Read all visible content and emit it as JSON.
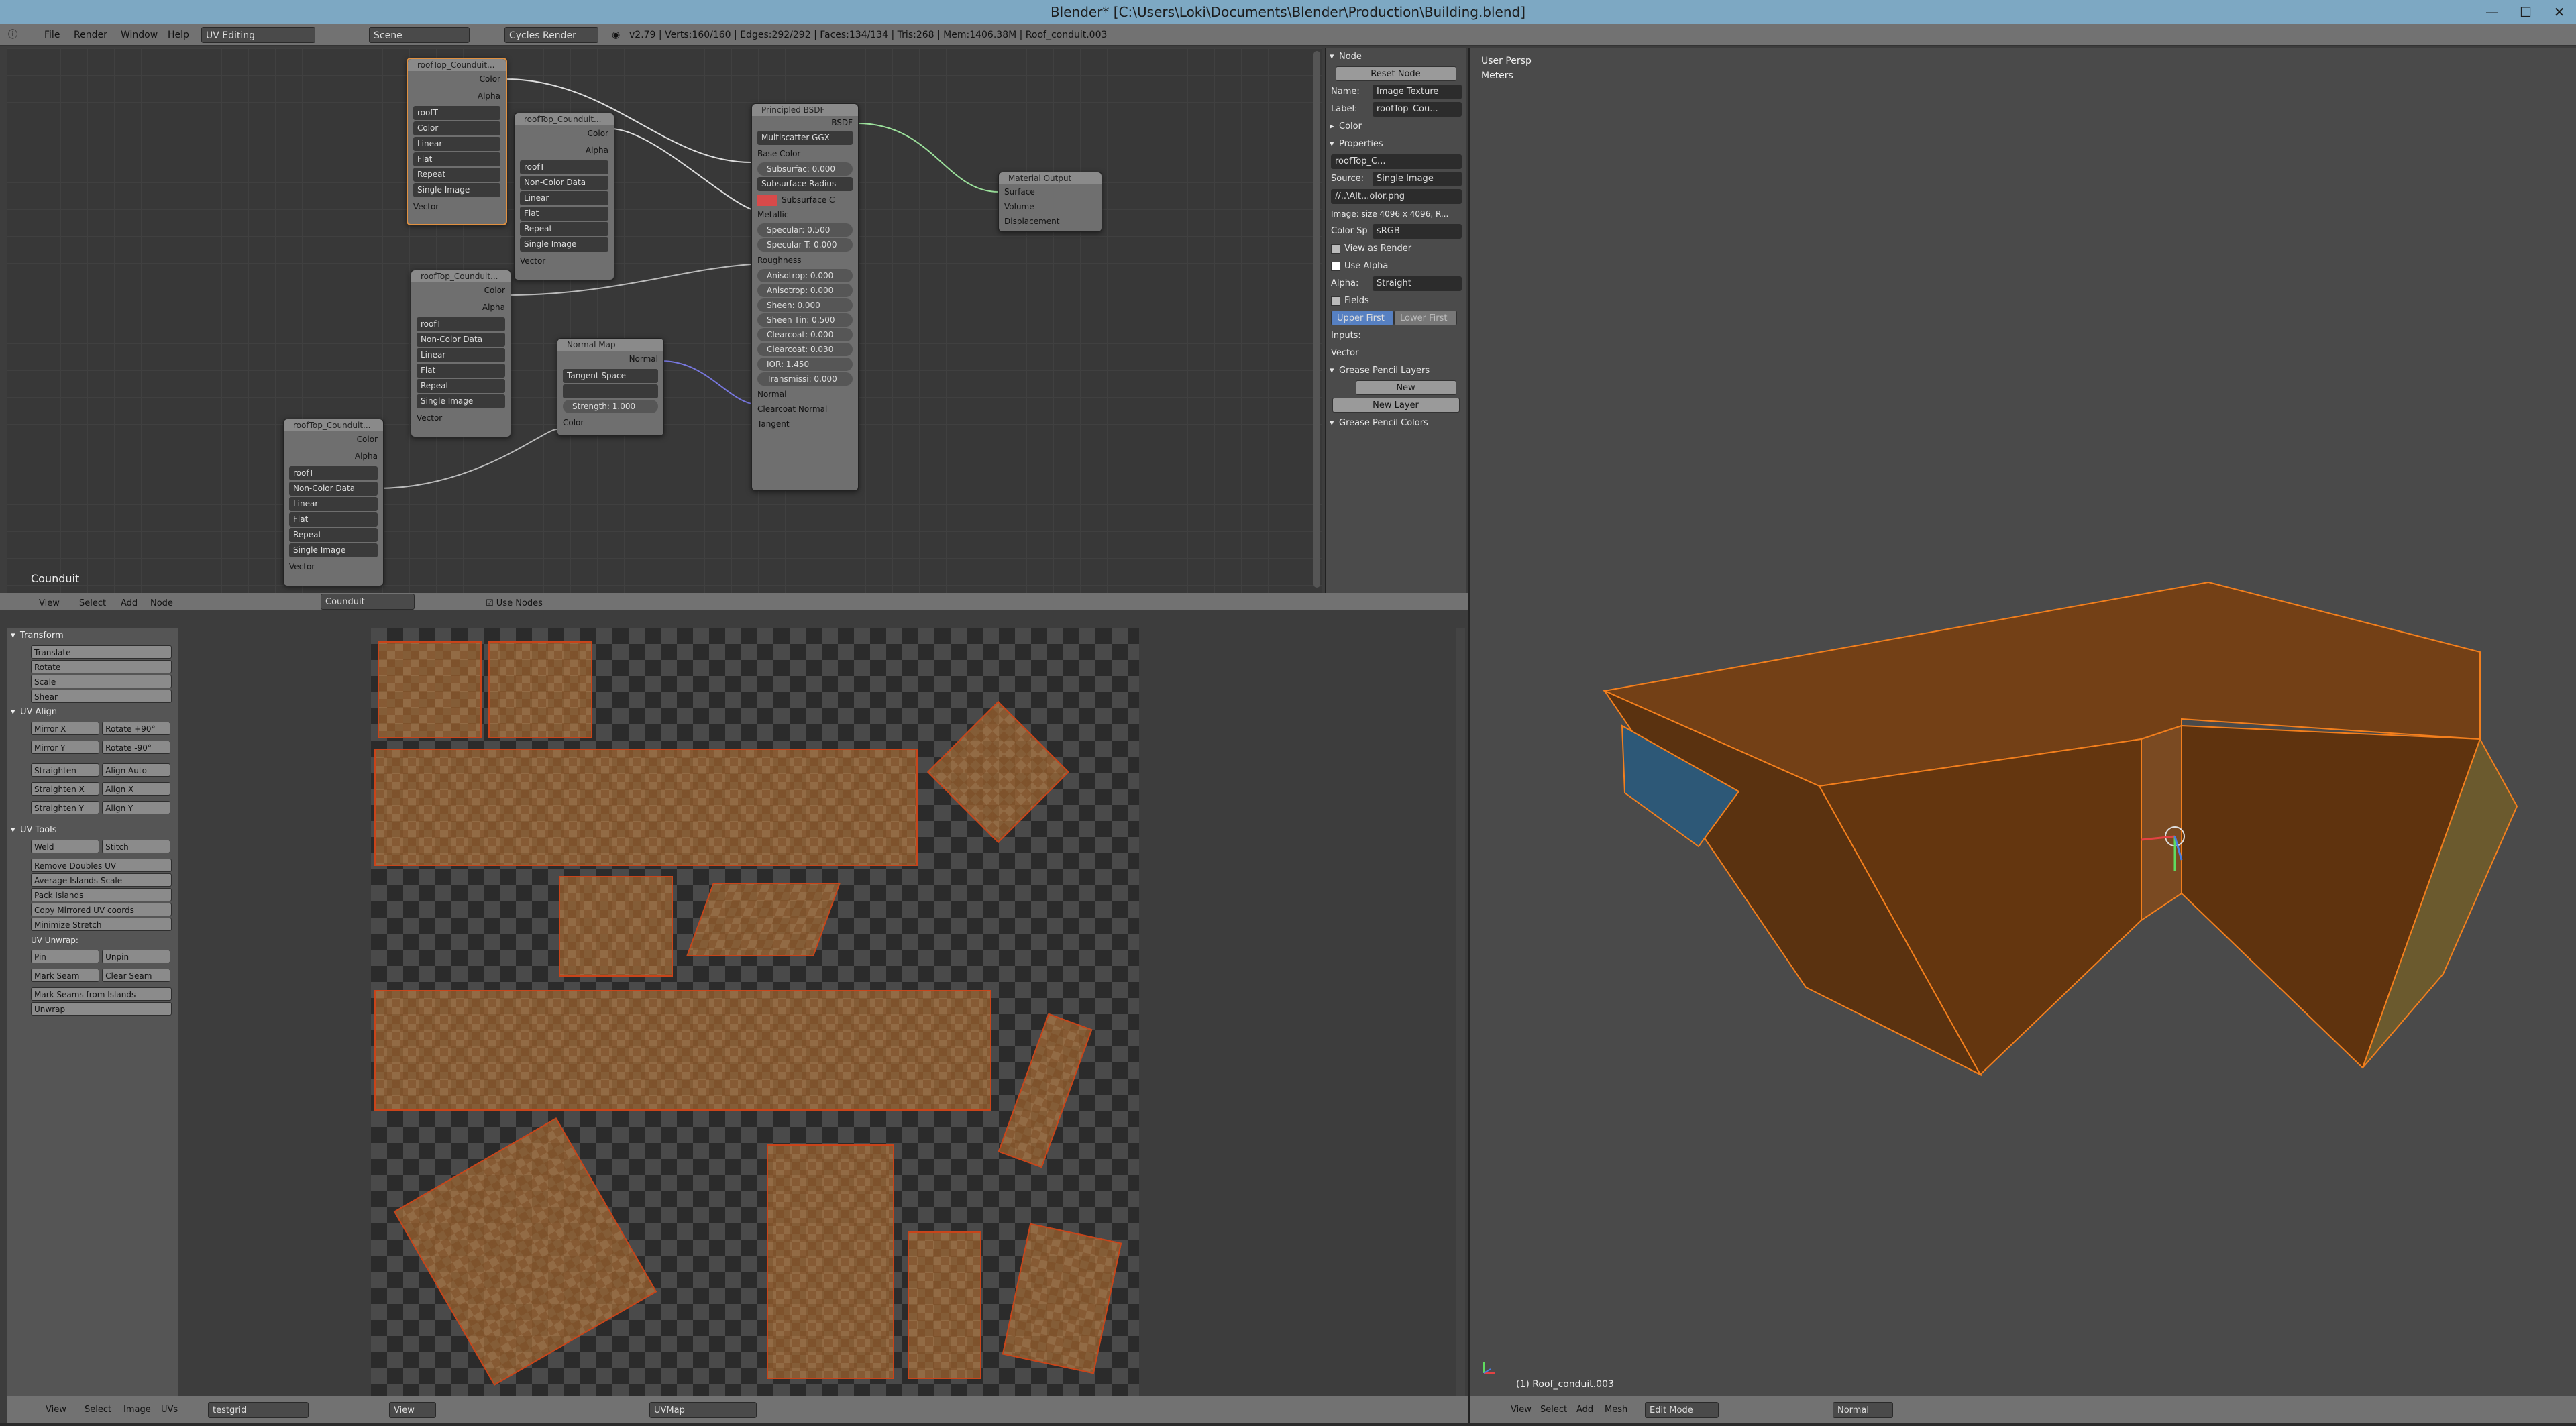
{
  "window": {
    "title": "Blender* [C:\\Users\\Loki\\Documents\\Blender\\Production\\Building.blend]",
    "minimize": "—",
    "maximize": "☐",
    "close": "✕"
  },
  "topbar": {
    "menus": [
      "File",
      "Render",
      "Window",
      "Help"
    ],
    "layout": "UV Editing",
    "scene": "Scene",
    "engine": "Cycles Render",
    "stats": "v2.79 | Verts:160/160 | Edges:292/292 | Faces:134/134 | Tris:268 | Mem:1406.38M | Roof_conduit.003"
  },
  "node_editor": {
    "footer_label": "Counduit",
    "nodes": {
      "tex1": {
        "title": "roofTop_Counduit...",
        "out1": "Color",
        "out2": "Alpha",
        "img": "roofT",
        "dd": [
          "Color",
          "Linear",
          "Flat",
          "Repeat",
          "Single Image"
        ],
        "in": "Vector"
      },
      "tex2": {
        "title": "roofTop_Counduit...",
        "out1": "Color",
        "out2": "Alpha",
        "img": "roofT",
        "dd": [
          "Non-Color Data",
          "Linear",
          "Flat",
          "Repeat",
          "Single Image"
        ],
        "in": "Vector"
      },
      "tex3": {
        "title": "roofTop_Counduit...",
        "out1": "Color",
        "out2": "Alpha",
        "img": "roofT",
        "dd": [
          "Non-Color Data",
          "Linear",
          "Flat",
          "Repeat",
          "Single Image"
        ],
        "in": "Vector"
      },
      "tex4": {
        "title": "roofTop_Counduit...",
        "out1": "Color",
        "out2": "Alpha",
        "img": "roofT",
        "dd": [
          "Non-Color Data",
          "Linear",
          "Flat",
          "Repeat",
          "Single Image"
        ],
        "in": "Vector"
      },
      "normal": {
        "title": "Normal Map",
        "out": "Normal",
        "space": "Tangent Space",
        "strength": "Strength:  1.000",
        "in": "Color"
      },
      "bsdf": {
        "title": "Principled BSDF",
        "out": "BSDF",
        "dist": "Multiscatter GGX",
        "base": "Base Color",
        "subsurface": "Subsurfac:  0.000",
        "ssr": "Subsurface Radius",
        "ssc": "Subsurface C",
        "metallic": "Metallic",
        "specular": "Specular:  0.500",
        "spectint": "Specular T: 0.000",
        "rough": "Roughness",
        "aniso": "Anisotrop: 0.000",
        "anisorot": "Anisotrop: 0.000",
        "sheen": "Sheen:  0.000",
        "sheentint": "Sheen Tin: 0.500",
        "clear": "Clearcoat: 0.000",
        "clearr": "Clearcoat: 0.030",
        "ior": "IOR:  1.450",
        "trans": "Transmissi: 0.000",
        "normal": "Normal",
        "cnormal": "Clearcoat Normal",
        "tangent": "Tangent"
      },
      "output": {
        "title": "Material Output",
        "in1": "Surface",
        "in2": "Volume",
        "in3": "Displacement"
      }
    }
  },
  "n_panel": {
    "node_head": "Node",
    "reset": "Reset Node",
    "name_label": "Name:",
    "name_val": "Image Texture",
    "label_label": "Label:",
    "label_val": "roofTop_Cou...",
    "color_head": "Color",
    "props_head": "Properties",
    "img": "roofTop_C...",
    "source_label": "Source:",
    "source_val": "Single Image",
    "path": "//..\\Alt...olor.png",
    "size": "Image: size 4096 x 4096, R...",
    "colorsp_label": "Color Sp",
    "colorsp_val": "sRGB",
    "view_render": "View as Render",
    "use_alpha": "Use Alpha",
    "alpha_label": "Alpha:",
    "alpha_val": "Straight",
    "fields": "Fields",
    "upper": "Upper First",
    "lower": "Lower First",
    "inputs": "Inputs:",
    "vector": "Vector",
    "gp_layers": "Grease Pencil Layers",
    "new": "New",
    "new_layer": "New Layer",
    "gp_colors": "Grease Pencil Colors"
  },
  "node_header": {
    "menus": [
      "View",
      "Select",
      "Add",
      "Node"
    ],
    "material": "Counduit",
    "use_nodes": "Use Nodes"
  },
  "uv_tools": {
    "transform": "Transform",
    "translate": "Translate",
    "rotate": "Rotate",
    "scale": "Scale",
    "shear": "Shear",
    "align": "UV Align",
    "mirror_x": "Mirror X",
    "rot_p90": "Rotate +90°",
    "mirror_y": "Mirror Y",
    "rot_m90": "Rotate -90°",
    "straighten": "Straighten",
    "align_auto": "Align Auto",
    "straighten_x": "Straighten X",
    "align_x": "Align X",
    "straighten_y": "Straighten Y",
    "align_y": "Align Y",
    "tools": "UV Tools",
    "weld": "Weld",
    "stitch": "Stitch",
    "remove_doubles": "Remove Doubles UV",
    "avg_islands": "Average Islands Scale",
    "pack": "Pack Islands",
    "copy_mirror": "Copy Mirrored UV coords",
    "min_stretch": "Minimize Stretch",
    "unwrap_label": "UV Unwrap:",
    "pin": "Pin",
    "unpin": "Unpin",
    "mark_seam": "Mark Seam",
    "clear_seam": "Clear Seam",
    "seams_islands": "Mark Seams from Islands",
    "unwrap": "Unwrap"
  },
  "uv_footer": {
    "menus": [
      "View",
      "Select",
      "Image",
      "UVs"
    ],
    "image": "testgrid",
    "view": "View",
    "uvmap": "UVMap"
  },
  "viewport": {
    "label1": "User Persp",
    "label2": "Meters",
    "object": "(1) Roof_conduit.003"
  },
  "vp_footer": {
    "menus": [
      "View",
      "Select",
      "Add",
      "Mesh"
    ],
    "mode": "Edit Mode",
    "orientation": "Normal"
  }
}
